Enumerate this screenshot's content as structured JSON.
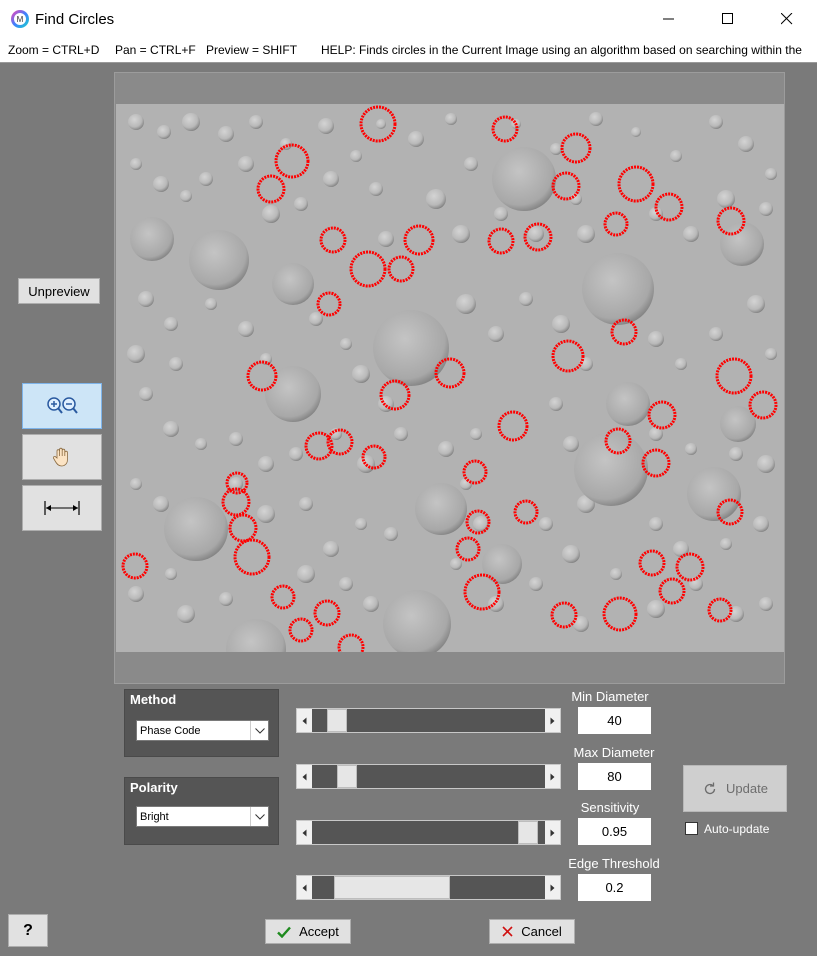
{
  "window": {
    "title": "Find Circles",
    "app_icon": "magnifier-logo-icon"
  },
  "hints": {
    "zoom": "Zoom = CTRL+D",
    "pan": "Pan = CTRL+F",
    "preview": "Preview = SHIFT",
    "help": "HELP:  Finds circles in the Current Image using an algorithm based on searching within the"
  },
  "preview": {
    "unpreview_label": "Unpreview"
  },
  "tools": {
    "zoom_icon": "zoom-in-out-icon",
    "pan_icon": "hand-icon",
    "measure_icon": "measure-icon"
  },
  "method": {
    "title": "Method",
    "selected": "Phase Code"
  },
  "polarity": {
    "title": "Polarity",
    "selected": "Bright"
  },
  "params": {
    "min_diameter": {
      "label": "Min Diameter",
      "value": "40",
      "slider_fraction": 0.05
    },
    "max_diameter": {
      "label": "Max Diameter",
      "value": "80",
      "slider_fraction": 0.1
    },
    "sensitivity": {
      "label": "Sensitivity",
      "value": "0.95",
      "slider_fraction": 0.95
    },
    "edge_threshold": {
      "label": "Edge Threshold",
      "value": "0.2",
      "slider_fraction": 0.2
    }
  },
  "update": {
    "label": "Update",
    "auto_update_label": "Auto-update",
    "auto_update_checked": false
  },
  "footer": {
    "help_label": "?",
    "accept_label": "Accept",
    "cancel_label": "Cancel"
  },
  "colors": {
    "detected_circle": "#ff0000",
    "panel_bg": "#7a7a7a",
    "group_bg": "#555555"
  }
}
